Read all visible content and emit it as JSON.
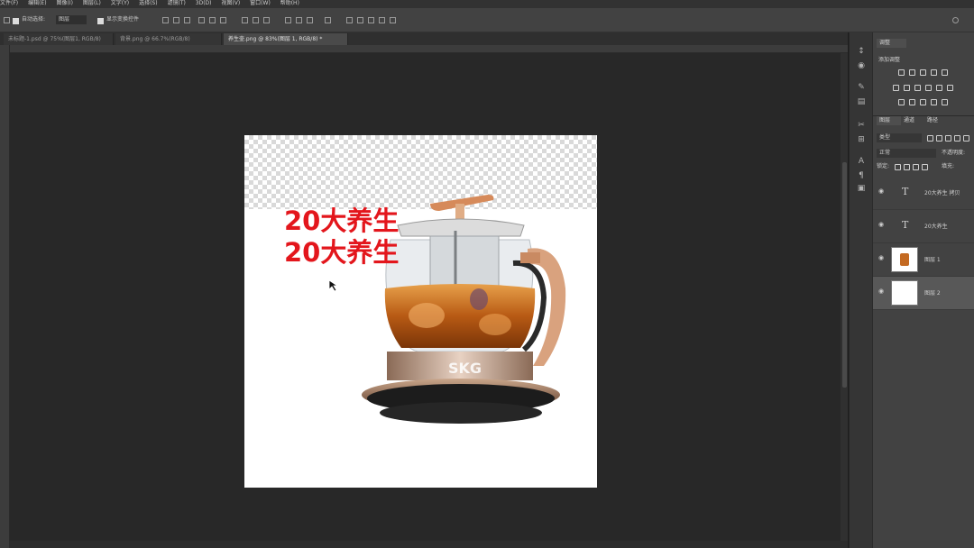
{
  "menu": {
    "items": [
      "文件(F)",
      "编辑(E)",
      "图像(I)",
      "图层(L)",
      "文字(Y)",
      "选择(S)",
      "滤镜(T)",
      "3D(D)",
      "视图(V)",
      "窗口(W)",
      "帮助(H)"
    ]
  },
  "options": {
    "auto_select_label": "自动选择:",
    "auto_select_value": "图层",
    "transform_controls_label": "显示变换控件"
  },
  "tabs": [
    {
      "label": "未标题-1.psd @ 75%(图层1, RGB/8)",
      "active": false
    },
    {
      "label": "背景.png @ 66.7%(RGB/8)",
      "active": false
    },
    {
      "label": "养生壶.png @ 83%(图层 1, RGB/8) *",
      "active": true
    }
  ],
  "canvas": {
    "text_line_1": "20大养生",
    "text_line_2": "20大养生",
    "product_brand": "SKG"
  },
  "panels": {
    "adjustments_tab": "调整",
    "add_adjustment_label": "添加调整",
    "layer_tabs": [
      "图层",
      "通道",
      "路径"
    ],
    "kind_filter": "类型",
    "blend_mode": "正常",
    "opacity_label": "不透明度:",
    "lock_label": "锁定:",
    "fill_label": "填充:"
  },
  "layers": [
    {
      "name": "20大养生 拷贝",
      "kind": "text",
      "visible": true,
      "selected": false
    },
    {
      "name": "20大养生",
      "kind": "text",
      "visible": true,
      "selected": false
    },
    {
      "name": "图层 1",
      "kind": "image",
      "visible": true,
      "selected": false
    },
    {
      "name": "图层 2",
      "kind": "fill",
      "visible": true,
      "selected": true
    }
  ],
  "colors": {
    "text_red": "#e3161c",
    "ui_dark": "#282828",
    "panel_bg": "#424242"
  }
}
